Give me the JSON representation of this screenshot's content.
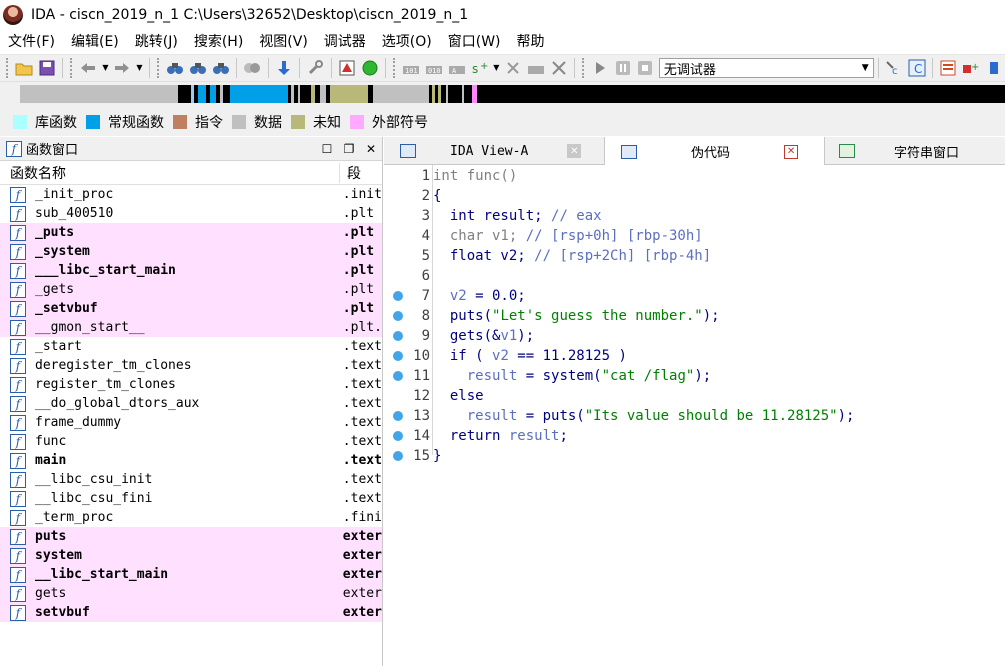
{
  "window": {
    "title": "IDA - ciscn_2019_n_1 C:\\Users\\32652\\Desktop\\ciscn_2019_n_1"
  },
  "menu": [
    "文件(F)",
    "编辑(E)",
    "跳转(J)",
    "搜索(H)",
    "视图(V)",
    "调试器",
    "选项(O)",
    "窗口(W)",
    "帮助"
  ],
  "toolbar": {
    "debugger_select": "无调试器"
  },
  "legend": [
    {
      "label": "库函数",
      "color": "#aaffff"
    },
    {
      "label": "常规函数",
      "color": "#00a0e8"
    },
    {
      "label": "指令",
      "color": "#c08060"
    },
    {
      "label": "数据",
      "color": "#c0c0c0"
    },
    {
      "label": "未知",
      "color": "#b8b878"
    },
    {
      "label": "外部符号",
      "color": "#ffaaff"
    }
  ],
  "functions_panel": {
    "title": "函数窗口",
    "col_name": "函数名称",
    "col_segment": "段",
    "rows": [
      {
        "name": "_init_proc",
        "seg": ".init",
        "pink": false,
        "bold": false
      },
      {
        "name": "sub_400510",
        "seg": ".plt",
        "pink": false,
        "bold": false
      },
      {
        "name": "_puts",
        "seg": ".plt",
        "pink": true,
        "bold": true
      },
      {
        "name": "_system",
        "seg": ".plt",
        "pink": true,
        "bold": true
      },
      {
        "name": "___libc_start_main",
        "seg": ".plt",
        "pink": true,
        "bold": true
      },
      {
        "name": "_gets",
        "seg": ".plt",
        "pink": true,
        "bold": false
      },
      {
        "name": "_setvbuf",
        "seg": ".plt",
        "pink": true,
        "bold": true
      },
      {
        "name": "__gmon_start__",
        "seg": ".plt.",
        "pink": true,
        "bold": false
      },
      {
        "name": "_start",
        "seg": ".text",
        "pink": false,
        "bold": false
      },
      {
        "name": "deregister_tm_clones",
        "seg": ".text",
        "pink": false,
        "bold": false
      },
      {
        "name": "register_tm_clones",
        "seg": ".text",
        "pink": false,
        "bold": false
      },
      {
        "name": "__do_global_dtors_aux",
        "seg": ".text",
        "pink": false,
        "bold": false
      },
      {
        "name": "frame_dummy",
        "seg": ".text",
        "pink": false,
        "bold": false
      },
      {
        "name": "func",
        "seg": ".text",
        "pink": false,
        "bold": false
      },
      {
        "name": "main",
        "seg": ".text",
        "pink": false,
        "bold": true
      },
      {
        "name": "__libc_csu_init",
        "seg": ".text",
        "pink": false,
        "bold": false
      },
      {
        "name": "__libc_csu_fini",
        "seg": ".text",
        "pink": false,
        "bold": false
      },
      {
        "name": "_term_proc",
        "seg": ".fini",
        "pink": false,
        "bold": false
      },
      {
        "name": "puts",
        "seg": "exter",
        "pink": true,
        "bold": true
      },
      {
        "name": "system",
        "seg": "exter",
        "pink": true,
        "bold": true
      },
      {
        "name": "__libc_start_main",
        "seg": "exter",
        "pink": true,
        "bold": true
      },
      {
        "name": "gets",
        "seg": "exter",
        "pink": true,
        "bold": false
      },
      {
        "name": "setvbuf",
        "seg": "exter",
        "pink": true,
        "bold": true
      }
    ]
  },
  "tabs": {
    "ida_view": "IDA View-A",
    "pseudocode": "伪代码",
    "strings": "字符串窗口"
  },
  "code": {
    "lines": [
      {
        "n": "1",
        "bp": false,
        "parts": [
          {
            "t": "int func()",
            "c": "c-gray"
          }
        ]
      },
      {
        "n": "2",
        "bp": false,
        "parts": [
          {
            "t": "{",
            "c": "c-kw"
          }
        ]
      },
      {
        "n": "3",
        "bp": false,
        "parts": [
          {
            "t": "  int result; ",
            "c": "c-kw"
          },
          {
            "t": "// eax",
            "c": "c-var"
          }
        ]
      },
      {
        "n": "4",
        "bp": false,
        "parts": [
          {
            "t": "  char v1; ",
            "c": "c-gray"
          },
          {
            "t": "// [rsp+0h] [rbp-30h]",
            "c": "c-var"
          }
        ]
      },
      {
        "n": "5",
        "bp": false,
        "parts": [
          {
            "t": "  float v2; ",
            "c": "c-kw"
          },
          {
            "t": "// [rsp+2Ch] [rbp-4h]",
            "c": "c-var"
          }
        ]
      },
      {
        "n": "6",
        "bp": false,
        "parts": [
          {
            "t": "",
            "c": "c-kw"
          }
        ]
      },
      {
        "n": "7",
        "bp": true,
        "parts": [
          {
            "t": "  ",
            "c": "c-kw"
          },
          {
            "t": "v2",
            "c": "c-var"
          },
          {
            "t": " = 0.0;",
            "c": "c-kw"
          }
        ]
      },
      {
        "n": "8",
        "bp": true,
        "parts": [
          {
            "t": "  puts(",
            "c": "c-kw"
          },
          {
            "t": "\"Let's guess the number.\"",
            "c": "c-str"
          },
          {
            "t": ");",
            "c": "c-kw"
          }
        ]
      },
      {
        "n": "9",
        "bp": true,
        "parts": [
          {
            "t": "  gets(&",
            "c": "c-kw"
          },
          {
            "t": "v1",
            "c": "c-var"
          },
          {
            "t": ");",
            "c": "c-kw"
          }
        ]
      },
      {
        "n": "10",
        "bp": true,
        "parts": [
          {
            "t": "  if ( ",
            "c": "c-kw"
          },
          {
            "t": "v2",
            "c": "c-var"
          },
          {
            "t": " == 11.28125 )",
            "c": "c-kw"
          }
        ]
      },
      {
        "n": "11",
        "bp": true,
        "parts": [
          {
            "t": "    ",
            "c": "c-kw"
          },
          {
            "t": "result",
            "c": "c-var"
          },
          {
            "t": " = system(",
            "c": "c-kw"
          },
          {
            "t": "\"cat /flag\"",
            "c": "c-str"
          },
          {
            "t": ");",
            "c": "c-kw"
          }
        ]
      },
      {
        "n": "12",
        "bp": false,
        "parts": [
          {
            "t": "  else",
            "c": "c-kw"
          }
        ]
      },
      {
        "n": "13",
        "bp": true,
        "parts": [
          {
            "t": "    ",
            "c": "c-kw"
          },
          {
            "t": "result",
            "c": "c-var"
          },
          {
            "t": " = puts(",
            "c": "c-kw"
          },
          {
            "t": "\"Its value should be 11.28125\"",
            "c": "c-str"
          },
          {
            "t": ");",
            "c": "c-kw"
          }
        ]
      },
      {
        "n": "14",
        "bp": true,
        "parts": [
          {
            "t": "  return ",
            "c": "c-kw"
          },
          {
            "t": "result",
            "c": "c-var"
          },
          {
            "t": ";",
            "c": "c-kw"
          }
        ]
      },
      {
        "n": "15",
        "bp": true,
        "parts": [
          {
            "t": "}",
            "c": "c-kw"
          }
        ]
      }
    ]
  }
}
